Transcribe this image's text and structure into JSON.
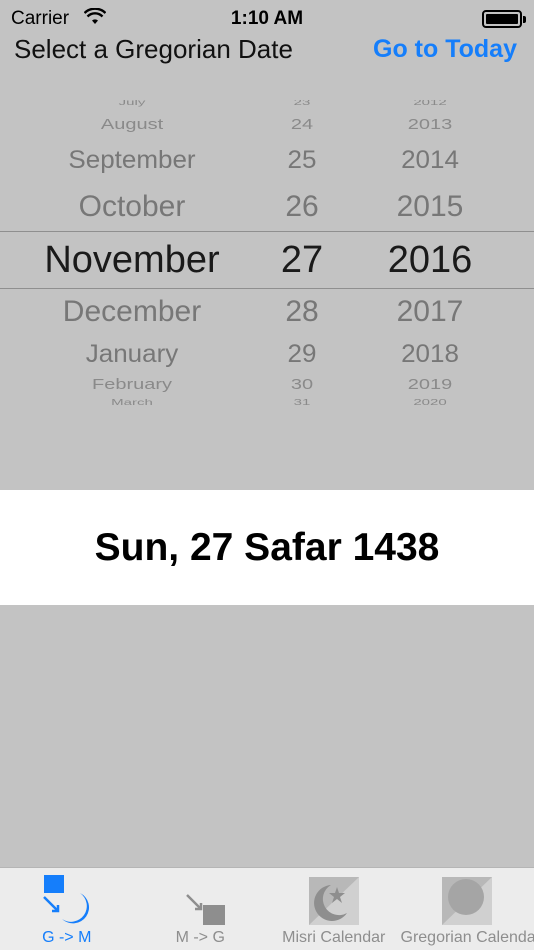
{
  "status_bar": {
    "carrier": "Carrier",
    "time": "1:10 AM"
  },
  "header": {
    "title": "Select a Gregorian Date",
    "action": "Go to Today"
  },
  "picker": {
    "rows": [
      {
        "month": "July",
        "day": "23",
        "year": "2012"
      },
      {
        "month": "August",
        "day": "24",
        "year": "2013"
      },
      {
        "month": "September",
        "day": "25",
        "year": "2014"
      },
      {
        "month": "October",
        "day": "26",
        "year": "2015"
      },
      {
        "month": "November",
        "day": "27",
        "year": "2016"
      },
      {
        "month": "December",
        "day": "28",
        "year": "2017"
      },
      {
        "month": "January",
        "day": "29",
        "year": "2018"
      },
      {
        "month": "February",
        "day": "30",
        "year": "2019"
      },
      {
        "month": "March",
        "day": "31",
        "year": "2020"
      }
    ],
    "selected": {
      "month": "November",
      "day": "27",
      "year": "2016"
    }
  },
  "result": {
    "text": "Sun, 27 Safar 1438"
  },
  "tabs": [
    {
      "label": "G -> M",
      "icon": "gregorian-to-misri-icon",
      "active": true
    },
    {
      "label": "M -> G",
      "icon": "misri-to-gregorian-icon",
      "active": false
    },
    {
      "label": "Misri Calendar",
      "icon": "misri-calendar-icon",
      "active": false
    },
    {
      "label": "Gregorian Calendar",
      "icon": "gregorian-calendar-icon",
      "active": false
    }
  ],
  "colors": {
    "accent": "#157efb",
    "background": "#c3c3c3",
    "result_background": "#ffffff"
  }
}
